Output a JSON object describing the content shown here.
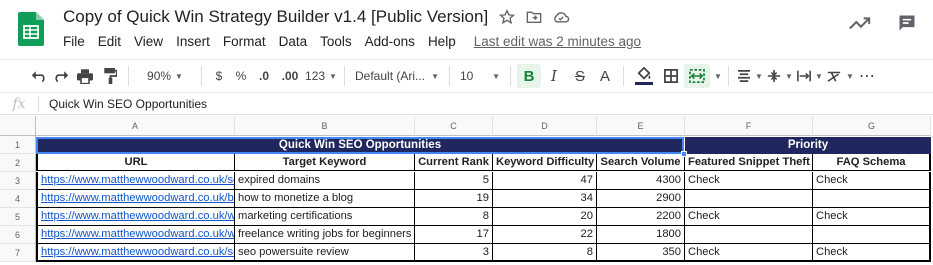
{
  "app": {
    "title": "Copy of Quick Win Strategy Builder v1.4 [Public Version]",
    "menu": [
      "File",
      "Edit",
      "View",
      "Insert",
      "Format",
      "Data",
      "Tools",
      "Add-ons",
      "Help"
    ],
    "last_edit": "Last edit was 2 minutes ago"
  },
  "toolbar": {
    "zoom": "90%",
    "currency": "$",
    "percent": "%",
    "decrease_decimal": ".0",
    "increase_decimal": ".00",
    "more_formats": "123",
    "font": "Default (Ari...",
    "font_size": "10",
    "bold": "B",
    "italic": "I",
    "strike": "S",
    "text_color": "A"
  },
  "formula_bar": {
    "fx": "fx",
    "content": "Quick Win SEO Opportunities"
  },
  "grid": {
    "columns": [
      "A",
      "B",
      "C",
      "D",
      "E",
      "F",
      "G"
    ],
    "rows": [
      "1",
      "2",
      "3",
      "4",
      "5",
      "6",
      "7"
    ],
    "band_main": "Quick Win SEO Opportunities",
    "band_priority": "Priority",
    "headers": [
      "URL",
      "Target Keyword",
      "Current Rank",
      "Keyword Difficulty",
      "Search Volume",
      "Featured Snippet Theft",
      "FAQ Schema"
    ],
    "data": [
      [
        "https://www.matthewwoodward.co.uk/se",
        "expired domains",
        "5",
        "47",
        "4300",
        "Check",
        "Check"
      ],
      [
        "https://www.matthewwoodward.co.uk/blo",
        "how to monetize a blog",
        "19",
        "34",
        "2900",
        "",
        ""
      ],
      [
        "https://www.matthewwoodward.co.uk/wo",
        "marketing certifications",
        "8",
        "20",
        "2200",
        "Check",
        "Check"
      ],
      [
        "https://www.matthewwoodward.co.uk/wo",
        "freelance writing jobs for beginners",
        "17",
        "22",
        "1800",
        "",
        ""
      ],
      [
        "https://www.matthewwoodward.co.uk/se",
        "seo powersuite review",
        "3",
        "8",
        "350",
        "Check",
        "Check"
      ]
    ]
  },
  "colors": {
    "band": "#20275f",
    "link": "#1155cc",
    "sheets_green": "#0f9d58"
  }
}
